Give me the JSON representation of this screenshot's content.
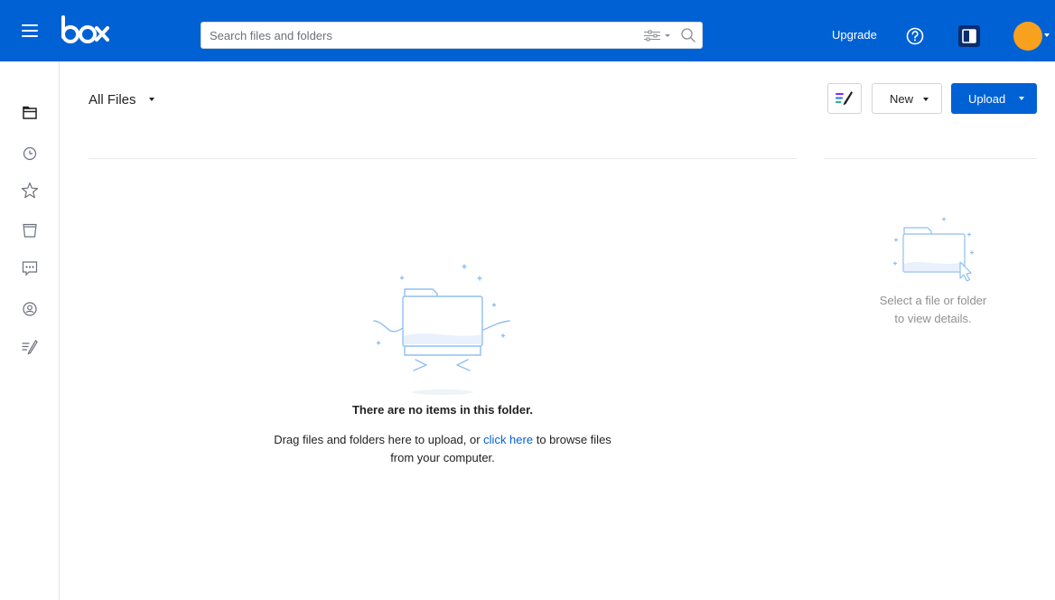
{
  "header": {
    "logo_text": "box",
    "search": {
      "placeholder": "Search files and folders",
      "value": ""
    },
    "upgrade_label": "Upgrade",
    "avatar_color": "#f8a11e",
    "brand_color": "#0061d5"
  },
  "leftnav": {
    "items": [
      {
        "icon": "folder-icon",
        "label": "All Files",
        "selected": true
      },
      {
        "icon": "clock-icon",
        "label": "Recents",
        "selected": false
      },
      {
        "icon": "star-icon",
        "label": "Favorites",
        "selected": false
      },
      {
        "icon": "trash-icon",
        "label": "Trash",
        "selected": false
      },
      {
        "icon": "comment-icon",
        "label": "Comments",
        "selected": false
      },
      {
        "icon": "user-icon",
        "label": "Account",
        "selected": false
      },
      {
        "icon": "notes-icon",
        "label": "Notes",
        "selected": false
      }
    ]
  },
  "main": {
    "folder_title": "All Files",
    "new_label": "New",
    "upload_label": "Upload",
    "empty": {
      "title": "There are no items in this folder.",
      "desc_before": "Drag files and folders here to upload, or ",
      "link_text": "click here",
      "desc_after": " to browse files from your computer."
    }
  },
  "details": {
    "line1": "Select a file or folder",
    "line2": "to view details."
  }
}
